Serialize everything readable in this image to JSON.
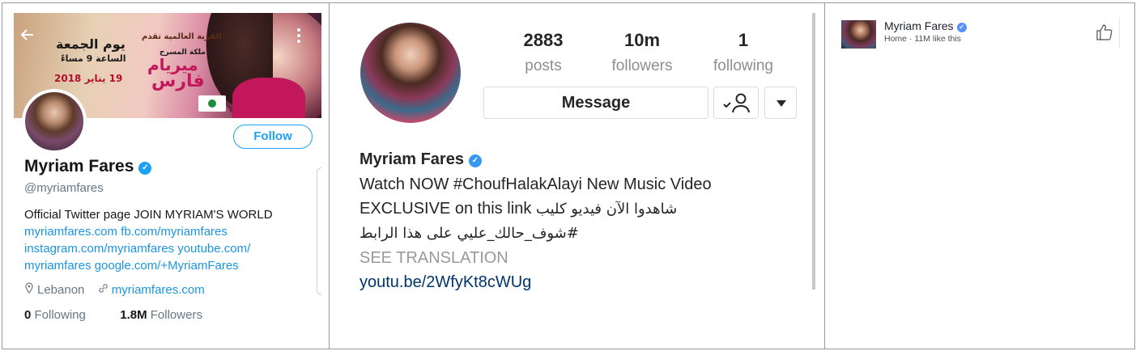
{
  "twitter": {
    "banner_text": {
      "line1": "القرية العالمية تقدم",
      "line2": "يوم الجمعة",
      "line3": "ملكة المسرح",
      "line4": "ميريام",
      "line5": "الساعة 9 مساءً",
      "line6": "فارس",
      "line7": "19 يناير 2018"
    },
    "follow_label": "Follow",
    "name": "Myriam Fares",
    "handle": "@myriamfares",
    "bio_text": "Official Twitter page JOIN MYRIAM'S WORLD",
    "bio_links": [
      "myriamfares.com",
      "fb.com/myriamfares",
      "instagram.com/myriamfares",
      "youtube.com/",
      "myriamfares",
      "google.com/+MyriamFares"
    ],
    "location": "Lebanon",
    "website": "myriamfares.com",
    "following_count": "0",
    "following_label": "Following",
    "followers_count": "1.8M",
    "followers_label": "Followers",
    "accent_color": "#1da1f2"
  },
  "instagram": {
    "posts_count": "2883",
    "posts_label": "posts",
    "followers_count": "10m",
    "followers_label": "followers",
    "following_count": "1",
    "following_label": "following",
    "message_label": "Message",
    "name": "Myriam Fares",
    "bio_line1": "Watch NOW #ChoufHalakAlayi New Music Video",
    "bio_line2_en": "EXCLUSIVE on this link",
    "bio_line2_ar": "شاهدوا الآن فيديو كليب",
    "bio_line3_ar": "#شوف_حالك_عليي على هذا الرابط",
    "see_translation": "SEE TRANSLATION",
    "link": "youtu.be/2WfyKt8cWUg"
  },
  "facebook": {
    "name": "Myriam Fares",
    "subtitle": "Home · 11M like this"
  }
}
